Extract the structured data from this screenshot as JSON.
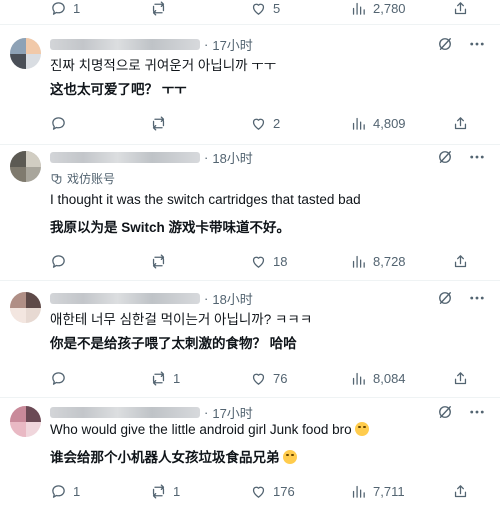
{
  "colors": {
    "text": "#0f1419",
    "muted": "#536471",
    "divider": "#eff3f4"
  },
  "top_actions": {
    "replies": "1",
    "reposts": "",
    "likes": "5",
    "views": "2,780"
  },
  "tweets": [
    {
      "time": "17小时",
      "lines": [
        "진짜 치명적으로 귀여운거 아닙니까 ㅜㅜ"
      ],
      "translation": "这也太可爱了吧？ ㅜㅜ",
      "badge": "",
      "actions": {
        "replies": "",
        "reposts": "",
        "likes": "2",
        "views": "4,809"
      },
      "avatar_colors": [
        "#d9dde2",
        "#8ea2b6",
        "#f1c9a9",
        "#4a4f57"
      ]
    },
    {
      "time": "18小时",
      "badge": "戏仿账号",
      "lines": [
        "I thought it was the switch cartridges that tasted bad"
      ],
      "translation": "我原以为是 Switch 游戏卡带味道不好。",
      "actions": {
        "replies": "",
        "reposts": "",
        "likes": "18",
        "views": "8,728"
      },
      "avatar_colors": [
        "#a8a59b",
        "#5c5a53",
        "#d1cdc2",
        "#7f7a6e"
      ]
    },
    {
      "time": "18小时",
      "badge": "",
      "lines": [
        "애한테 너무 심한걸 먹이는거 아닙니까? ㅋㅋㅋ"
      ],
      "translation": "你是不是给孩子喂了太刺激的食物？ 哈哈",
      "actions": {
        "replies": "",
        "reposts": "1",
        "likes": "76",
        "views": "8,084"
      },
      "avatar_colors": [
        "#e7d9d2",
        "#b08f86",
        "#5e4a48",
        "#f3e6e0"
      ]
    },
    {
      "time": "17小时",
      "badge": "",
      "lines": [
        "Who would give the little android girl Junk food bro"
      ],
      "translation": "谁会给那个小机器人女孩垃圾食品兄弟",
      "actions": {
        "replies": "1",
        "reposts": "1",
        "likes": "176",
        "views": "7,711"
      },
      "avatar_colors": [
        "#f0d6dc",
        "#c98a9a",
        "#6b4a55",
        "#e9b9c4"
      ]
    }
  ]
}
